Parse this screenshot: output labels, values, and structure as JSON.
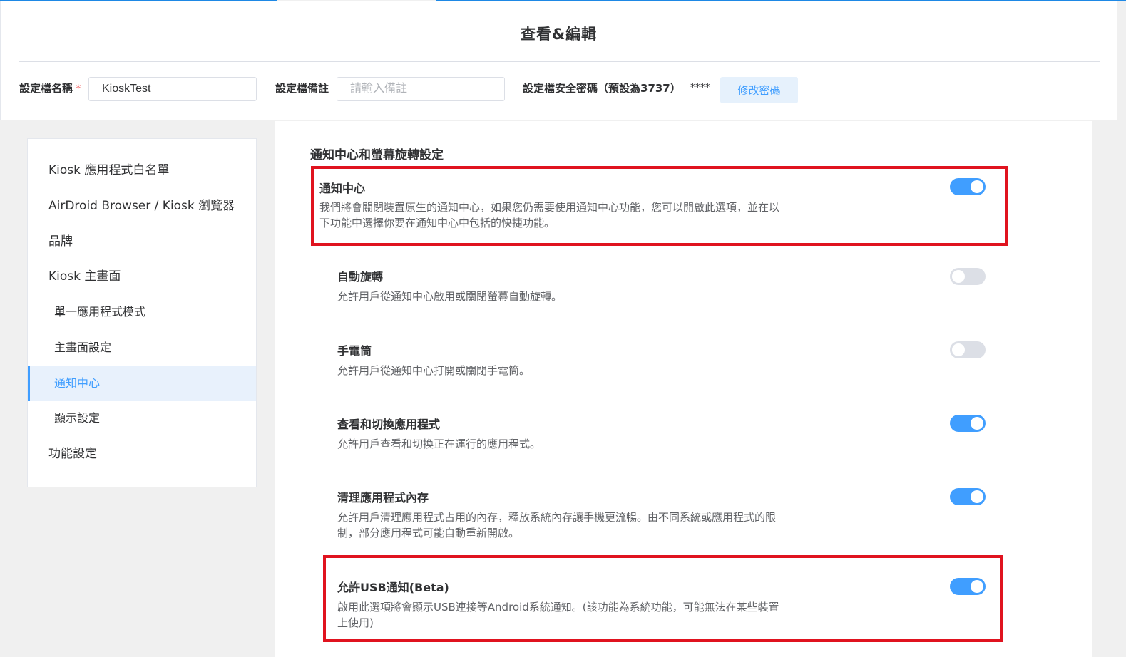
{
  "header": {
    "title": "查看&編輯",
    "profile_name_label": "設定檔名稱",
    "required_mark": "*",
    "profile_name_value": "KioskTest",
    "note_label": "設定檔備註",
    "note_placeholder": "請輸入備註",
    "password_label": "設定檔安全密碼（預設為3737）",
    "password_masked": "****",
    "change_password_button": "修改密碼"
  },
  "sidebar": {
    "items": [
      {
        "label": "Kiosk 應用程式白名單",
        "level": "top",
        "active": false
      },
      {
        "label": "AirDroid Browser / Kiosk 瀏覽器",
        "level": "top",
        "active": false
      },
      {
        "label": "品牌",
        "level": "top",
        "active": false
      },
      {
        "label": "Kiosk 主畫面",
        "level": "top",
        "active": false
      },
      {
        "label": "單一應用程式模式",
        "level": "sub",
        "active": false
      },
      {
        "label": "主畫面設定",
        "level": "sub",
        "active": false
      },
      {
        "label": "通知中心",
        "level": "sub",
        "active": true
      },
      {
        "label": "顯示設定",
        "level": "sub",
        "active": false
      },
      {
        "label": "功能設定",
        "level": "top",
        "active": false
      }
    ]
  },
  "main": {
    "section_title": "通知中心和螢幕旋轉設定",
    "settings": [
      {
        "title": "通知中心",
        "desc_line1": "我們將會關閉裝置原生的通知中心，如果您仍需要使用通知中心功能，您可以開啟此選項，並在以",
        "desc_line2": "下功能中選擇你要在通知中心中包括的快捷功能。",
        "enabled": true,
        "highlighted": true
      },
      {
        "title": "自動旋轉",
        "desc_line1": "允許用戶從通知中心啟用或關閉螢幕自動旋轉。",
        "desc_line2": "",
        "enabled": false,
        "highlighted": false
      },
      {
        "title": "手電筒",
        "desc_line1": "允許用戶從通知中心打開或關閉手電筒。",
        "desc_line2": "",
        "enabled": false,
        "highlighted": false
      },
      {
        "title": "查看和切換應用程式",
        "desc_line1": "允許用戶查看和切換正在運行的應用程式。",
        "desc_line2": "",
        "enabled": true,
        "highlighted": false
      },
      {
        "title": "清理應用程式內存",
        "desc_line1": "允許用戶清理應用程式占用的內存，釋放系統內存讓手機更流暢。由不同系統或應用程式的限",
        "desc_line2": "制，部分應用程式可能自動重新開啟。",
        "enabled": true,
        "highlighted": false
      },
      {
        "title": "允許USB通知(Beta)",
        "desc_line1": "啟用此選項將會顯示USB連接等Android系統通知。(該功能為系統功能，可能無法在某些裝置",
        "desc_line2": "上使用)",
        "enabled": true,
        "highlighted": true
      }
    ]
  },
  "colors": {
    "accent": "#409eff",
    "highlight": "#e0131f",
    "toggle_off": "#dcdfe6"
  }
}
